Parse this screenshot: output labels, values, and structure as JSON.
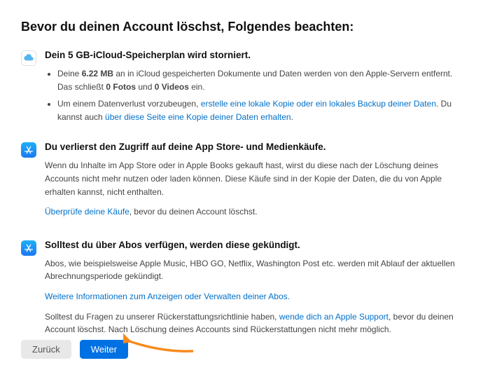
{
  "title": "Bevor du deinen Account löschst, Folgendes beachten:",
  "sections": {
    "icloud": {
      "heading": "Dein 5 GB-iCloud-Speicherplan wird storniert.",
      "bullet1_a": "Deine ",
      "bullet1_b_strong": "6.22 MB",
      "bullet1_c": " an in iCloud gespeicherten Dokumente und Daten werden von den Apple-Servern entfernt. Das schließt ",
      "bullet1_d_strong": "0 Fotos",
      "bullet1_e": " und ",
      "bullet1_f_strong": "0 Videos",
      "bullet1_g": " ein.",
      "bullet2_a": "Um einem Datenverlust vorzubeugen, ",
      "bullet2_link1": "erstelle eine lokale Kopie oder ein lokales Backup deiner Daten",
      "bullet2_b": ". Du kannst auch ",
      "bullet2_link2": "über diese Seite eine Kopie deiner Daten erhalten",
      "bullet2_c": "."
    },
    "appstore": {
      "heading": "Du verlierst den Zugriff auf deine App Store- und Medienkäufe.",
      "p1": "Wenn du Inhalte im App Store oder in Apple Books gekauft hast, wirst du diese nach der Löschung deines Accounts nicht mehr nutzen oder laden können. Diese Käufe sind in der Kopie der Daten, die du von Apple erhalten kannst, nicht enthalten.",
      "p2_link": "Überprüfe deine Käufe",
      "p2_b": ", bevor du deinen Account löschst."
    },
    "subs": {
      "heading": "Solltest du über Abos verfügen, werden diese gekündigt.",
      "p1": "Abos, wie beispielsweise Apple Music, HBO GO, Netflix, Washington Post etc. werden mit Ablauf der aktuellen Abrechnungsperiode gekündigt.",
      "p2_link": "Weitere Informationen zum Anzeigen oder Verwalten deiner Abos.",
      "p3_a": "Solltest du Fragen zu unserer Rückerstattungsrichtlinie haben, ",
      "p3_link": "wende dich an Apple Support",
      "p3_b": ", bevor du deinen Account löschst. Nach Löschung deines Accounts sind Rückerstattungen nicht mehr möglich."
    }
  },
  "buttons": {
    "back": "Zurück",
    "next": "Weiter"
  }
}
